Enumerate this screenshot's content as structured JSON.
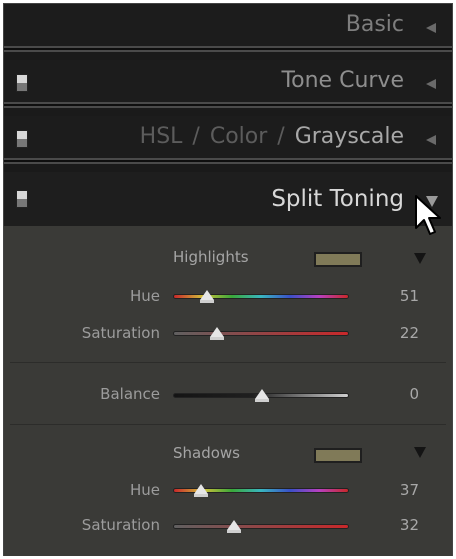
{
  "panels": {
    "basic": "Basic",
    "tone_curve": "Tone Curve",
    "hsl": {
      "part1": "HSL",
      "sep1": "/",
      "part2": "Color",
      "sep2": "/",
      "part3": "Grayscale"
    },
    "split_toning": "Split Toning"
  },
  "highlights": {
    "label": "Highlights",
    "swatch_color": "#807a58",
    "hue_label": "Hue",
    "hue_value": "51",
    "saturation_label": "Saturation",
    "saturation_value": "22"
  },
  "balance": {
    "label": "Balance",
    "value": "0"
  },
  "shadows": {
    "label": "Shadows",
    "swatch_color": "#807a58",
    "hue_label": "Hue",
    "hue_value": "37",
    "saturation_label": "Saturation",
    "saturation_value": "32"
  }
}
